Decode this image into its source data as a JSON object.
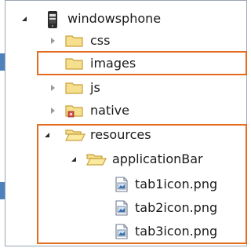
{
  "tree": {
    "root": {
      "label": "windowsphone",
      "icon": "phone-project-icon",
      "expanded": true
    },
    "items": [
      {
        "label": "css",
        "icon": "folder-icon",
        "expanded": false
      },
      {
        "label": "images",
        "icon": "folder-icon",
        "expanded": false,
        "highlighted": true
      },
      {
        "label": "js",
        "icon": "folder-icon",
        "expanded": false
      },
      {
        "label": "native",
        "icon": "folder-with-overlay-icon",
        "expanded": false
      },
      {
        "label": "resources",
        "icon": "folder-open-icon",
        "expanded": true,
        "highlighted": true
      },
      {
        "label": "applicationBar",
        "icon": "folder-open-icon",
        "expanded": true
      },
      {
        "label": "tab1icon.png",
        "icon": "image-file-icon"
      },
      {
        "label": "tab2icon.png",
        "icon": "image-file-icon"
      },
      {
        "label": "tab3icon.png",
        "icon": "image-file-icon"
      }
    ]
  },
  "colors": {
    "highlight_border": "#e46c1e",
    "callout_arrow": "#4f81bd",
    "folder_fill": "#f6e08f",
    "folder_stroke": "#c9a13a"
  }
}
